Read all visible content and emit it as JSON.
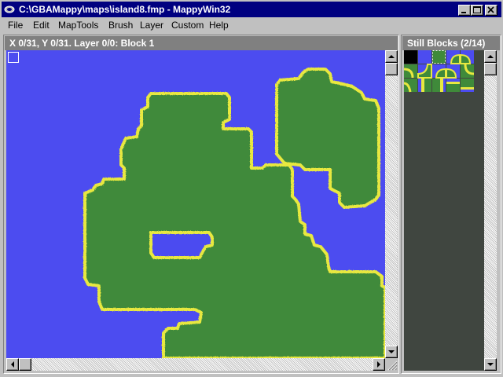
{
  "window": {
    "title": "C:\\GBAMappy\\maps\\island8.fmp - MappyWin32",
    "buttons": [
      "minimize",
      "maximize",
      "close"
    ]
  },
  "menu": [
    {
      "label": "File"
    },
    {
      "label": "Edit"
    },
    {
      "label": "MapTools"
    },
    {
      "label": "Brush"
    },
    {
      "label": "Layer"
    },
    {
      "label": "Custom"
    },
    {
      "label": "Help"
    }
  ],
  "map_panel": {
    "status": "X 0/31, Y 0/31. Layer 0/0: Block 1"
  },
  "blocks_panel": {
    "title": "Still Blocks (2/14)"
  },
  "colors": {
    "water": "#4c4cf0",
    "grass": "#3f8a3a",
    "sand": "#e8e840",
    "title_bar": "#000080",
    "panel_header": "#808080",
    "tile_bg": "#404640"
  },
  "icons": [
    "mappy-app-icon",
    "minimize-icon",
    "maximize-icon",
    "close-icon",
    "arrow-up-icon",
    "arrow-down-icon",
    "arrow-left-icon",
    "arrow-right-icon",
    "size-grip-icon"
  ]
}
